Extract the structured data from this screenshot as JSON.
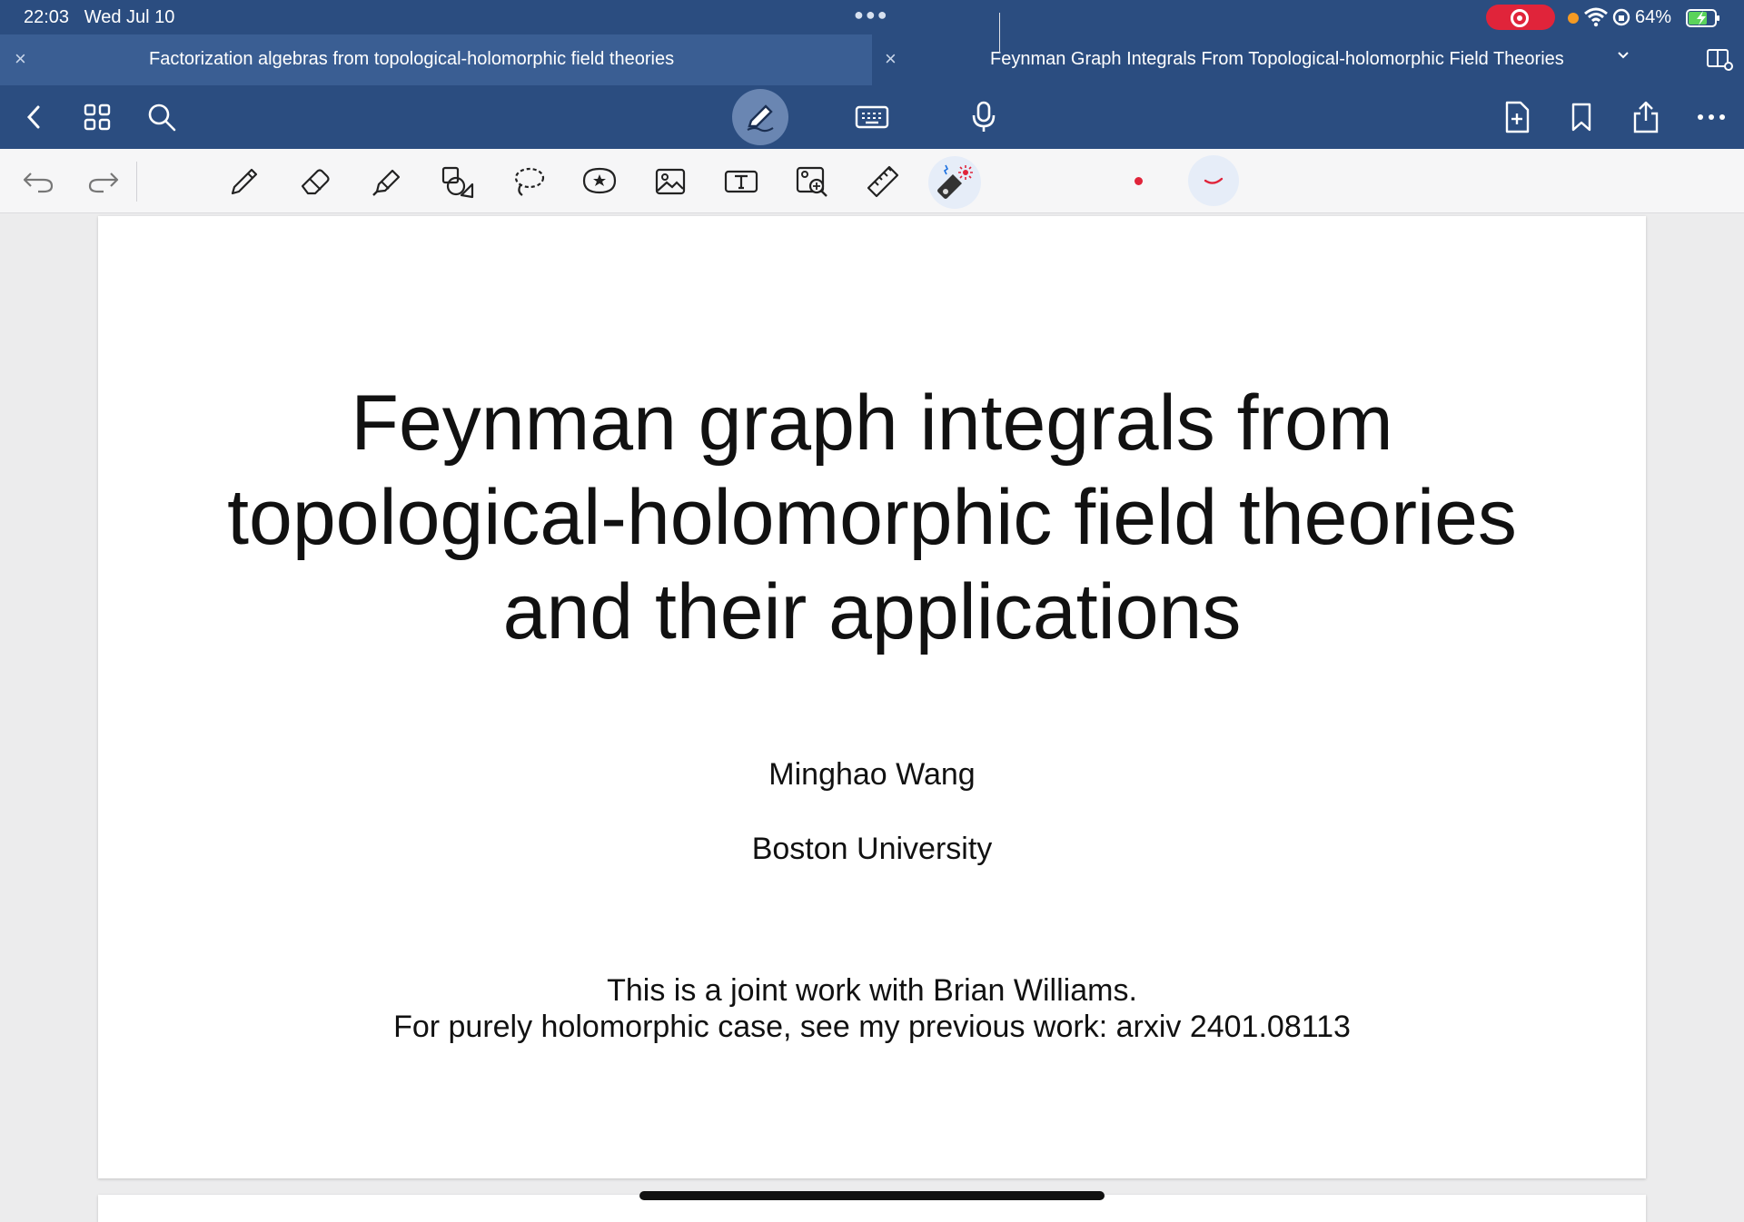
{
  "status": {
    "time": "22:03",
    "date": "Wed Jul 10",
    "battery": "64%"
  },
  "tabs": [
    {
      "title": "Factorization algebras from topological-holomorphic field theories",
      "close": "×"
    },
    {
      "title": "Feynman Graph Integrals From Topological-holomorphic Field Theories",
      "close": "×"
    }
  ],
  "icons": {
    "back": "chevron-left-icon",
    "grid": "grid-icon",
    "search": "search-icon",
    "pen_mode": "pen-mode-icon",
    "keyboard": "keyboard-icon",
    "mic": "microphone-icon",
    "add_page": "add-page-icon",
    "bookmark": "bookmark-icon",
    "share": "share-icon",
    "more": "more-icon"
  },
  "colors": {
    "navy": "#2b4d80",
    "active_pen": "#e0243a"
  },
  "document": {
    "title_lines": [
      "Feynman graph integrals from",
      "topological-holomorphic field theories",
      "and their applications"
    ],
    "author": "Minghao Wang",
    "affiliation": "Boston University",
    "note_line1": "This is a joint work with Brian Williams.",
    "note_line2": "For purely holomorphic case, see my previous work: arxiv 2401.08113"
  }
}
